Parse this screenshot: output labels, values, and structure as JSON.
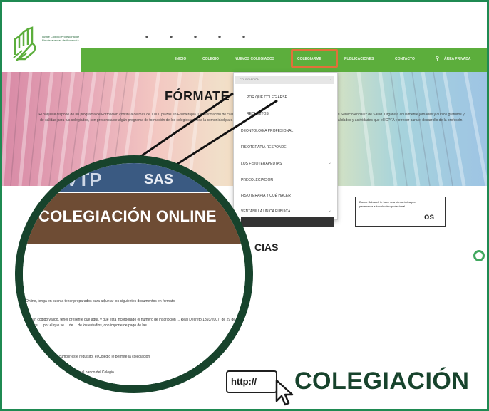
{
  "header": {
    "org_name": "Ilustre Colegio Profesional de Fisioterapeutas de Andalucía",
    "social_icons": [
      "facebook-icon",
      "twitter-icon",
      "instagram-icon",
      "linkedin-icon",
      "youtube-icon"
    ],
    "nav": [
      {
        "label": "INICIO"
      },
      {
        "label": "COLEGIO"
      },
      {
        "label": "NUEVOS COLEGIADOS"
      },
      {
        "label": "COLEGIARME",
        "active": true
      },
      {
        "label": "PUBLICACIONES"
      },
      {
        "label": "CONTACTO"
      },
      {
        "label": "ÁREA PRIVADA"
      }
    ]
  },
  "hero": {
    "title": "FÓRMATE C",
    "text": "El paquete dispone de un programa de Formación continua de más de 1.000 plazas en Fisioterapia. Una formación de calidad, en el ámbito de la Fisioterapia y el Bienestar para el ámbito del Servicio Andaluz de Salud. Organiza anualmente jornadas y cursos gratuitos y de calidad para tus colegiados, con presencia de algún programa de formación de los colegios de toda la comunidad para estar en un programa de formación para acceder a nuevas especialidades y actividades que el ICPFA y ofrecer para el desarrollo de la profesión."
  },
  "dropdown": {
    "header": "COLEGIACIÓN",
    "items": [
      {
        "label": "POR QUÉ COLEGIARSE",
        "chevron": false
      },
      {
        "label": "REQUISITOS",
        "chevron": false
      },
      {
        "label": "DEONTOLOGÍA PROFESIONAL",
        "chevron": false
      },
      {
        "label": "FISIOTERAPIA RESPONDE",
        "chevron": false
      },
      {
        "label": "LOS FISIOTERAPEUTAS",
        "chevron": true
      },
      {
        "label": "PRECOLEGIACIÓN",
        "chevron": false
      },
      {
        "label": "FISIOTERAPIA Y QUÉ HACER",
        "chevron": false
      },
      {
        "label": "VENTANILLA ÚNICA PÚBLICA",
        "chevron": true
      }
    ]
  },
  "infobox": {
    "text": "Banco Sabadell te hace una oferta única por pertenecer a tu colectivo profesional.",
    "logo": "os"
  },
  "side": {
    "heading": "CIAS"
  },
  "magnifier": {
    "tab1": "VTP",
    "tab2": "SAS",
    "title": "COLEGIACIÓN ONLINE",
    "paragraph1": "Online, tenga en cuenta tener preparados para adjuntar los siguientes documentos en formato",
    "paragraph2": "con un código válido, tener presente que aquí, y que está incorporado el número de inscripción ... Real Decreto 1393/2007, de 29 de octubre, ... por el que se ... de ... de los estudios, con importe de pago de las",
    "paragraph3": "... puede cumplir este requisito, el Colegio le permite la colegiación",
    "paragraph4": "... en el banco del Colegio"
  },
  "badge": {
    "url": "http://",
    "word": "COLEGIACIÓN"
  },
  "colors": {
    "nav_green": "#5cae3c",
    "frame_green": "#1f8a52",
    "dark_green": "#17432c",
    "active_outline": "#e2703a"
  }
}
